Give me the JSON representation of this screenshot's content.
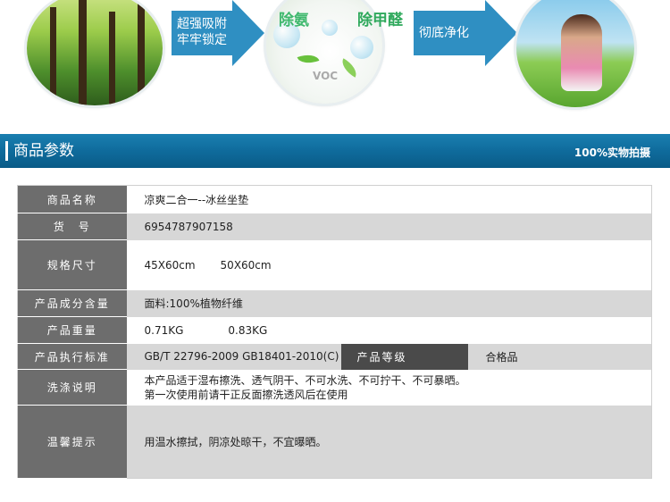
{
  "hero": {
    "step1_label": "超强吸附牢牢锁定",
    "step2_label": "彻底净化",
    "bubble1": "除氨",
    "bubble2": "除甲醛",
    "voc_text": "VOC"
  },
  "banner": {
    "title": "商品参数",
    "subtitle": "100%实物拍摄"
  },
  "specs": {
    "rows": [
      {
        "label": "商品名称",
        "value": "凉爽二合一--冰丝坐垫"
      },
      {
        "label": "货　号",
        "value": "6954787907158"
      },
      {
        "label": "规格尺寸",
        "value": "45X60cm",
        "value2": "50X60cm"
      },
      {
        "label": "产品成分含量",
        "value": "面料:100%植物纤维"
      },
      {
        "label": "产品重量",
        "value": "0.71KG",
        "value2": "0.83KG"
      },
      {
        "label": "产品执行标准",
        "value": "GB/T 22796-2009 GB18401-2010(C)",
        "label2": "产品等级",
        "value3": "合格品"
      },
      {
        "label": "洗涤说明",
        "value": "本产品适于湿布擦洗、透气阴干、不可水洗、不可拧干、不可暴晒。",
        "value_line2": "第一次使用前请干正反面擦洗透风后在使用"
      },
      {
        "label": "温馨提示",
        "value": "用温水擦拭，阴凉处晾干，不宜曝晒。"
      }
    ]
  },
  "colors": {
    "accent": "#2f8fc2",
    "banner": "#0f6b9c",
    "label_bg": "#6d6d6d"
  }
}
